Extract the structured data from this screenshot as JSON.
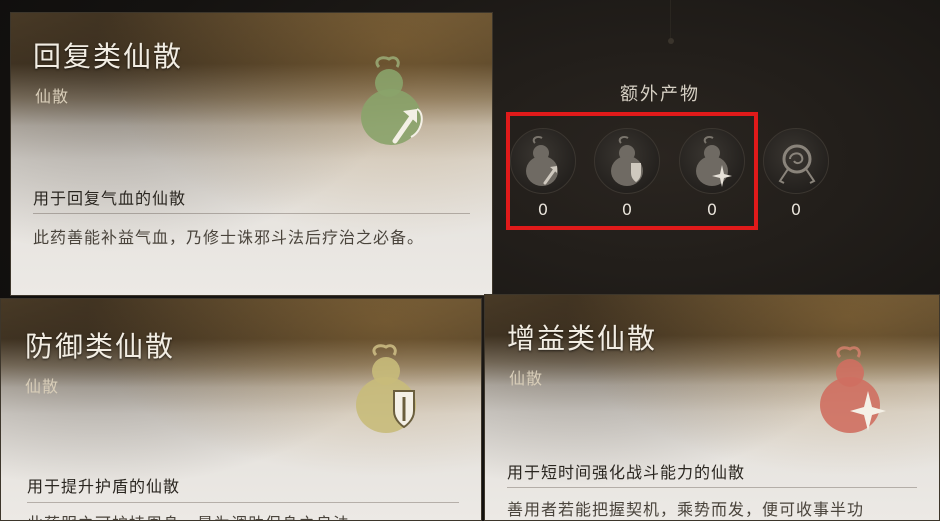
{
  "cards": {
    "restore": {
      "title": "回复类仙散",
      "subtitle": "仙散",
      "desc_title": "用于回复气血的仙散",
      "desc": "此药善能补益气血，乃修士诛邪斗法后疗治之必备。",
      "icon": "gourd-green-arrow-icon",
      "icon_color": "#8aa36a"
    },
    "defense": {
      "title": "防御类仙散",
      "subtitle": "仙散",
      "desc_title": "用于提升护盾的仙散",
      "desc": "此药服之可护持周身，最为调助保身之良法",
      "icon": "gourd-yellow-shield-icon",
      "icon_color": "#c8bb7a"
    },
    "buff": {
      "title": "增益类仙散",
      "subtitle": "仙散",
      "desc_title": "用于短时间强化战斗能力的仙散",
      "desc": "善用者若能把握契机，乘势而发，便可收事半功",
      "icon": "gourd-red-star-icon",
      "icon_color": "#cf6f60"
    }
  },
  "extra": {
    "title": "额外产物",
    "slots": [
      {
        "icon": "gourd-arrow-icon",
        "count": "0"
      },
      {
        "icon": "gourd-shield-icon",
        "count": "0"
      },
      {
        "icon": "gourd-star-icon",
        "count": "0"
      },
      {
        "icon": "swirl-medallion-icon",
        "count": "0"
      }
    ],
    "highlight_color": "#e01a1a"
  }
}
